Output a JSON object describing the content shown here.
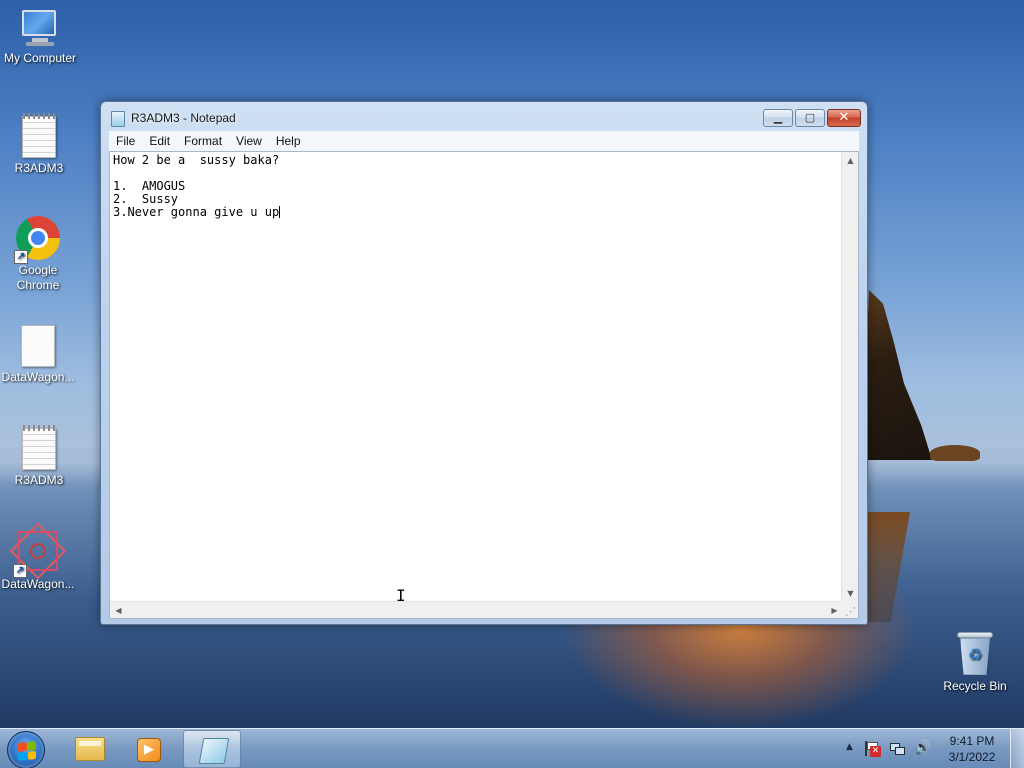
{
  "desktop": {
    "icons": [
      {
        "label": "My Computer"
      },
      {
        "label": "R3ADM3"
      },
      {
        "label": "Google Chrome"
      },
      {
        "label": "DataWagon..."
      },
      {
        "label": "R3ADM3"
      },
      {
        "label": "DataWagon..."
      },
      {
        "label": "Recycle Bin"
      }
    ]
  },
  "notepad": {
    "title": "R3ADM3 - Notepad",
    "menu": [
      "File",
      "Edit",
      "Format",
      "View",
      "Help"
    ],
    "content_lines": [
      "How 2 be a  sussy baka?",
      "",
      "1.  AMOGUS",
      "2.  Sussy",
      "3.Never gonna give u up"
    ],
    "caption_buttons": {
      "minimize": "▁",
      "maximize": "▢",
      "close": "✕"
    }
  },
  "taskbar": {
    "pinned": [
      "windows-explorer",
      "windows-media-player",
      "notepad"
    ],
    "active": "notepad",
    "clock": {
      "time": "9:41 PM",
      "date": "3/1/2022"
    }
  }
}
